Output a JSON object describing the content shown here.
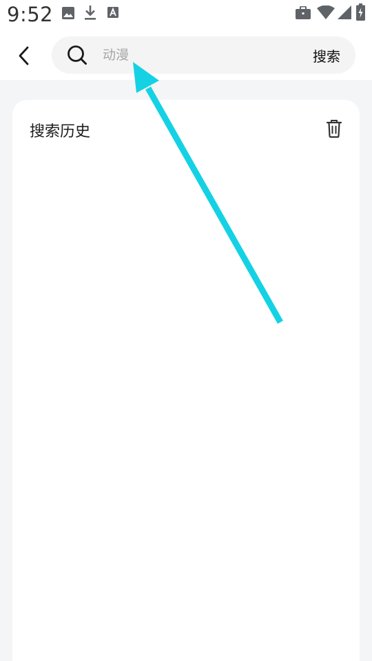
{
  "status_bar": {
    "time": "9:52",
    "left_icons": [
      "image-icon",
      "download-icon",
      "font-icon"
    ],
    "right_icons": [
      "briefcase-icon",
      "wifi-icon",
      "signal-icon",
      "battery-charging-icon"
    ]
  },
  "header": {
    "back_icon": "chevron-left-icon",
    "search": {
      "icon": "search-icon",
      "placeholder": "动漫",
      "value": ""
    },
    "search_button_label": "搜索"
  },
  "history": {
    "title": "搜索历史",
    "clear_icon": "trash-icon",
    "items": []
  },
  "colors": {
    "page_bg": "#f4f5f7",
    "card_bg": "#ffffff",
    "search_bg": "#f4f4f5",
    "placeholder": "#a6a6a6",
    "annotation_arrow": "#14d2e4"
  }
}
